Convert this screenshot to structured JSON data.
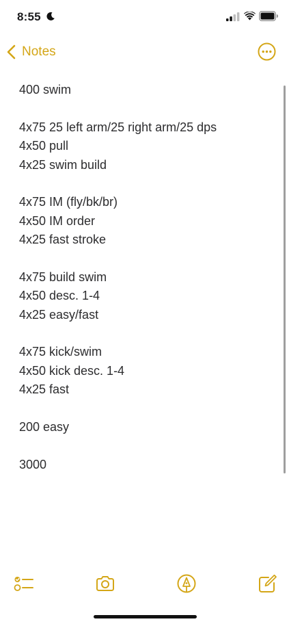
{
  "status_bar": {
    "time": "8:55",
    "focus_icon": "moon-icon",
    "signal_icon": "cellular-signal-icon",
    "wifi_icon": "wifi-icon",
    "battery_icon": "battery-icon"
  },
  "nav": {
    "back_label": "Notes",
    "back_icon": "chevron-left-icon",
    "more_icon": "ellipsis-circle-icon"
  },
  "note": {
    "lines": [
      "400 swim",
      "",
      "4x75 25 left arm/25 right arm/25 dps",
      "4x50 pull",
      "4x25 swim build",
      "",
      "4x75 IM (fly/bk/br)",
      "4x50 IM order",
      "4x25 fast stroke",
      "",
      "4x75 build swim",
      "4x50 desc. 1-4",
      "4x25 easy/fast",
      "",
      "4x75 kick/swim",
      "4x50 kick desc. 1-4",
      "4x25 fast",
      "",
      "200 easy",
      "",
      "3000"
    ]
  },
  "toolbar": {
    "items": [
      "checklist-icon",
      "camera-icon",
      "markup-pen-icon",
      "compose-icon"
    ]
  },
  "colors": {
    "accent": "#d4a617",
    "text": "#2c2c2e",
    "background": "#ffffff"
  }
}
